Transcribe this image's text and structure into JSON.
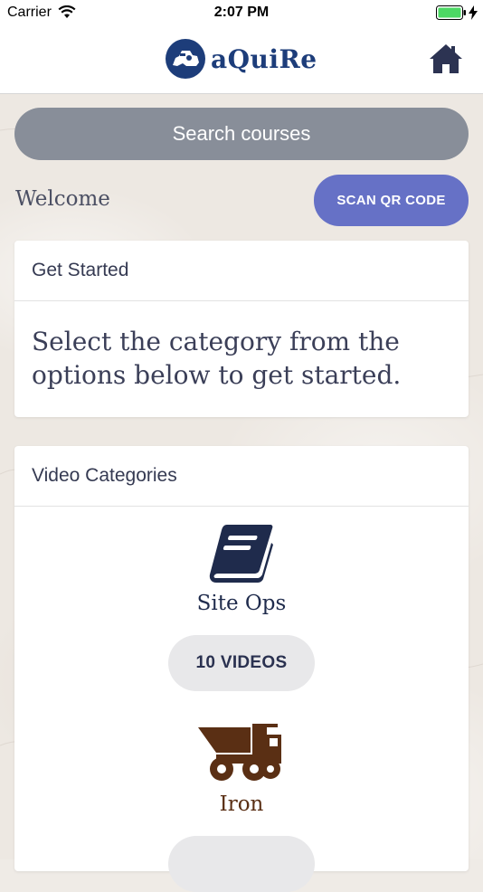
{
  "status_bar": {
    "carrier": "Carrier",
    "time": "2:07 PM"
  },
  "nav": {
    "logo_text": "aQuiRe",
    "logo_color": "#1d3d7a"
  },
  "search": {
    "placeholder": "Search courses"
  },
  "welcome": "Welcome",
  "scan_button": "SCAN QR CODE",
  "get_started": {
    "title": "Get Started",
    "body": "Select the category from the options below to get started."
  },
  "video_categories": {
    "title": "Video Categories",
    "items": [
      {
        "label": "Site Ops",
        "count_label": "10 VIDEOS",
        "icon": "book-icon",
        "color": "#1f2b4c"
      },
      {
        "label": "Iron",
        "count_label": "",
        "icon": "haul-truck-icon",
        "color": "#5a2f14"
      }
    ]
  },
  "colors": {
    "accent": "#6671c6",
    "search_bg": "#888e99"
  }
}
